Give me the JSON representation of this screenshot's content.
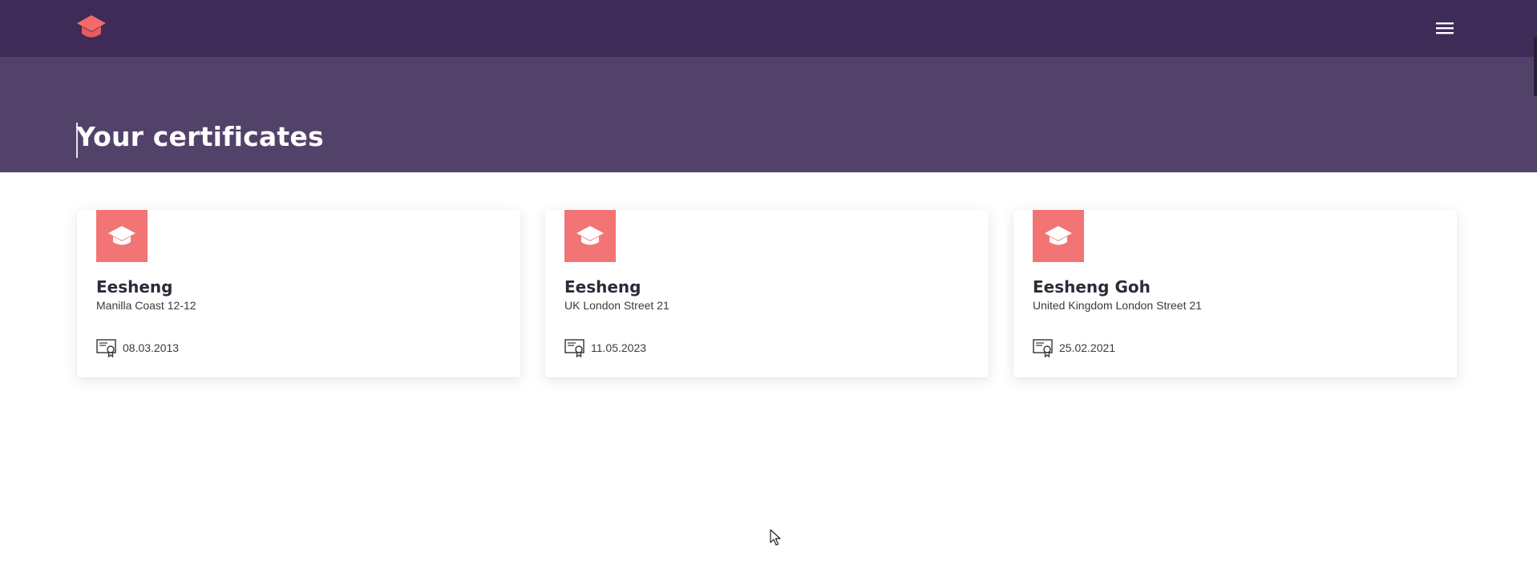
{
  "header": {
    "logo_icon": "graduation-cap-icon",
    "menu_icon": "hamburger-menu-icon"
  },
  "hero": {
    "title": "Your certificates"
  },
  "certificates": [
    {
      "name": "Eesheng",
      "address": "Manilla Coast 12-12",
      "date": "08.03.2013",
      "badge_icon": "graduation-cap-icon",
      "date_icon": "certificate-icon"
    },
    {
      "name": "Eesheng",
      "address": "UK London Street 21",
      "date": "11.05.2023",
      "badge_icon": "graduation-cap-icon",
      "date_icon": "certificate-icon"
    },
    {
      "name": "Eesheng Goh",
      "address": "United Kingdom London Street 21",
      "date": "25.02.2021",
      "badge_icon": "graduation-cap-icon",
      "date_icon": "certificate-icon"
    }
  ],
  "colors": {
    "topbar": "#3f2b58",
    "hero": "#52426a",
    "accent": "#f27474",
    "text_dark": "#2c2b38"
  }
}
